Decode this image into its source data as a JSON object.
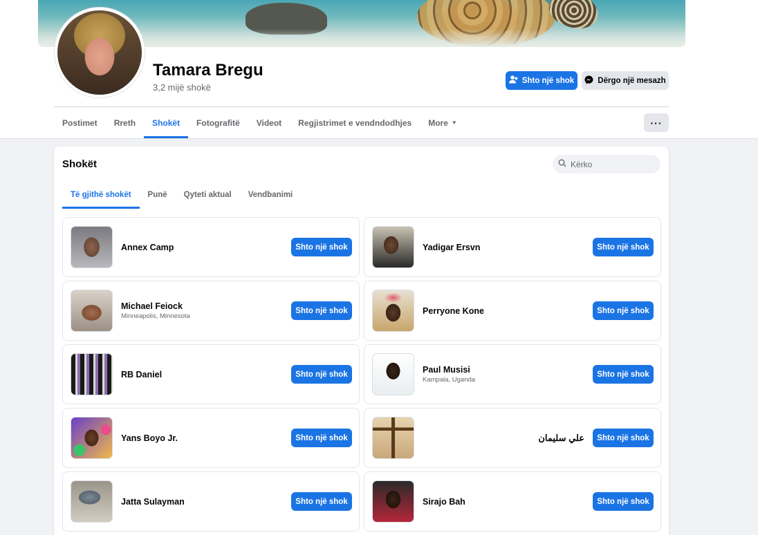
{
  "profile": {
    "name": "Tamara Bregu",
    "friend_count": "3,2 mijë shokë",
    "add_friend_label": "Shto një shok",
    "message_label": "Dërgo një mesazh",
    "more_label": "···"
  },
  "nav": {
    "tabs": [
      {
        "label": "Postimet"
      },
      {
        "label": "Rreth"
      },
      {
        "label": "Shokët"
      },
      {
        "label": "Fotografitë"
      },
      {
        "label": "Videot"
      },
      {
        "label": "Regjistrimet e vendndodhjes"
      },
      {
        "label": "More"
      }
    ],
    "active": "Shokët"
  },
  "friends_section": {
    "title": "Shokët",
    "search_placeholder": "Kërko",
    "subtabs": [
      {
        "label": "Të gjithë shokët"
      },
      {
        "label": "Punë"
      },
      {
        "label": "Qyteti aktual"
      },
      {
        "label": "Vendbanimi"
      }
    ],
    "add_label": "Shto një shok",
    "friends": [
      {
        "name": "Annex Camp",
        "location": ""
      },
      {
        "name": "Yadigar Ersvn",
        "location": ""
      },
      {
        "name": "Michael Feiock",
        "location": "Minneapolis, Minnesota"
      },
      {
        "name": "Perryone Kone",
        "location": ""
      },
      {
        "name": "RB Daniel",
        "location": ""
      },
      {
        "name": "Paul Musisi",
        "location": "Kampala, Uganda"
      },
      {
        "name": "Yans Boyo Jr.",
        "location": ""
      },
      {
        "name": "علي سليمان",
        "location": ""
      },
      {
        "name": "Jatta Sulayman",
        "location": ""
      },
      {
        "name": "Sirajo Bah",
        "location": ""
      }
    ]
  },
  "colors": {
    "accent": "#1b74e4",
    "background": "#f0f2f5",
    "secondary_button": "#e4e6eb",
    "muted_text": "#65676b"
  }
}
